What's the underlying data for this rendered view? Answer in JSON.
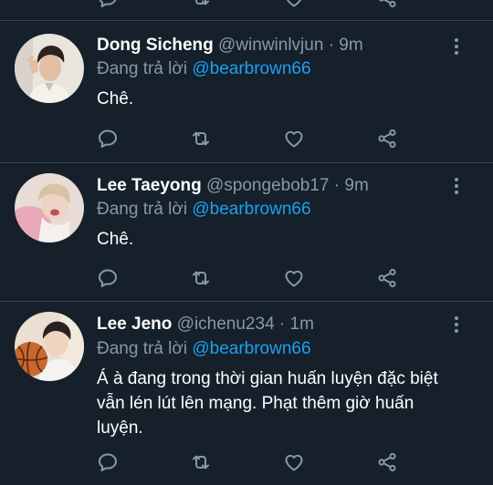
{
  "tweets": [
    {
      "name": "Dong Sicheng",
      "handle": "@winwinlvjun",
      "separator": "·",
      "time": "9m",
      "reply_prefix": "Đang trả lời",
      "reply_to": "@bearbrown66",
      "text": "Chê."
    },
    {
      "name": "Lee Taeyong",
      "handle": "@spongebob17",
      "separator": "·",
      "time": "9m",
      "reply_prefix": "Đang trả lời",
      "reply_to": "@bearbrown66",
      "text": "Chê."
    },
    {
      "name": "Lee Jeno",
      "handle": "@ichenu234",
      "separator": "·",
      "time": "1m",
      "reply_prefix": "Đang trả lời",
      "reply_to": "@bearbrown66",
      "text": "Á à đang trong thời gian huấn luyện đặc biệt vẫn lén lút lên mạng. Phạt thêm giờ huấn luyện."
    }
  ],
  "icons": [
    "reply-icon",
    "retweet-icon",
    "like-icon",
    "share-icon",
    "more-icon"
  ],
  "colors": {
    "background": "#15202b",
    "divider": "#38444d",
    "secondary_text": "#8899a6",
    "mention": "#1da1f2",
    "primary_text": "#ffffff"
  }
}
